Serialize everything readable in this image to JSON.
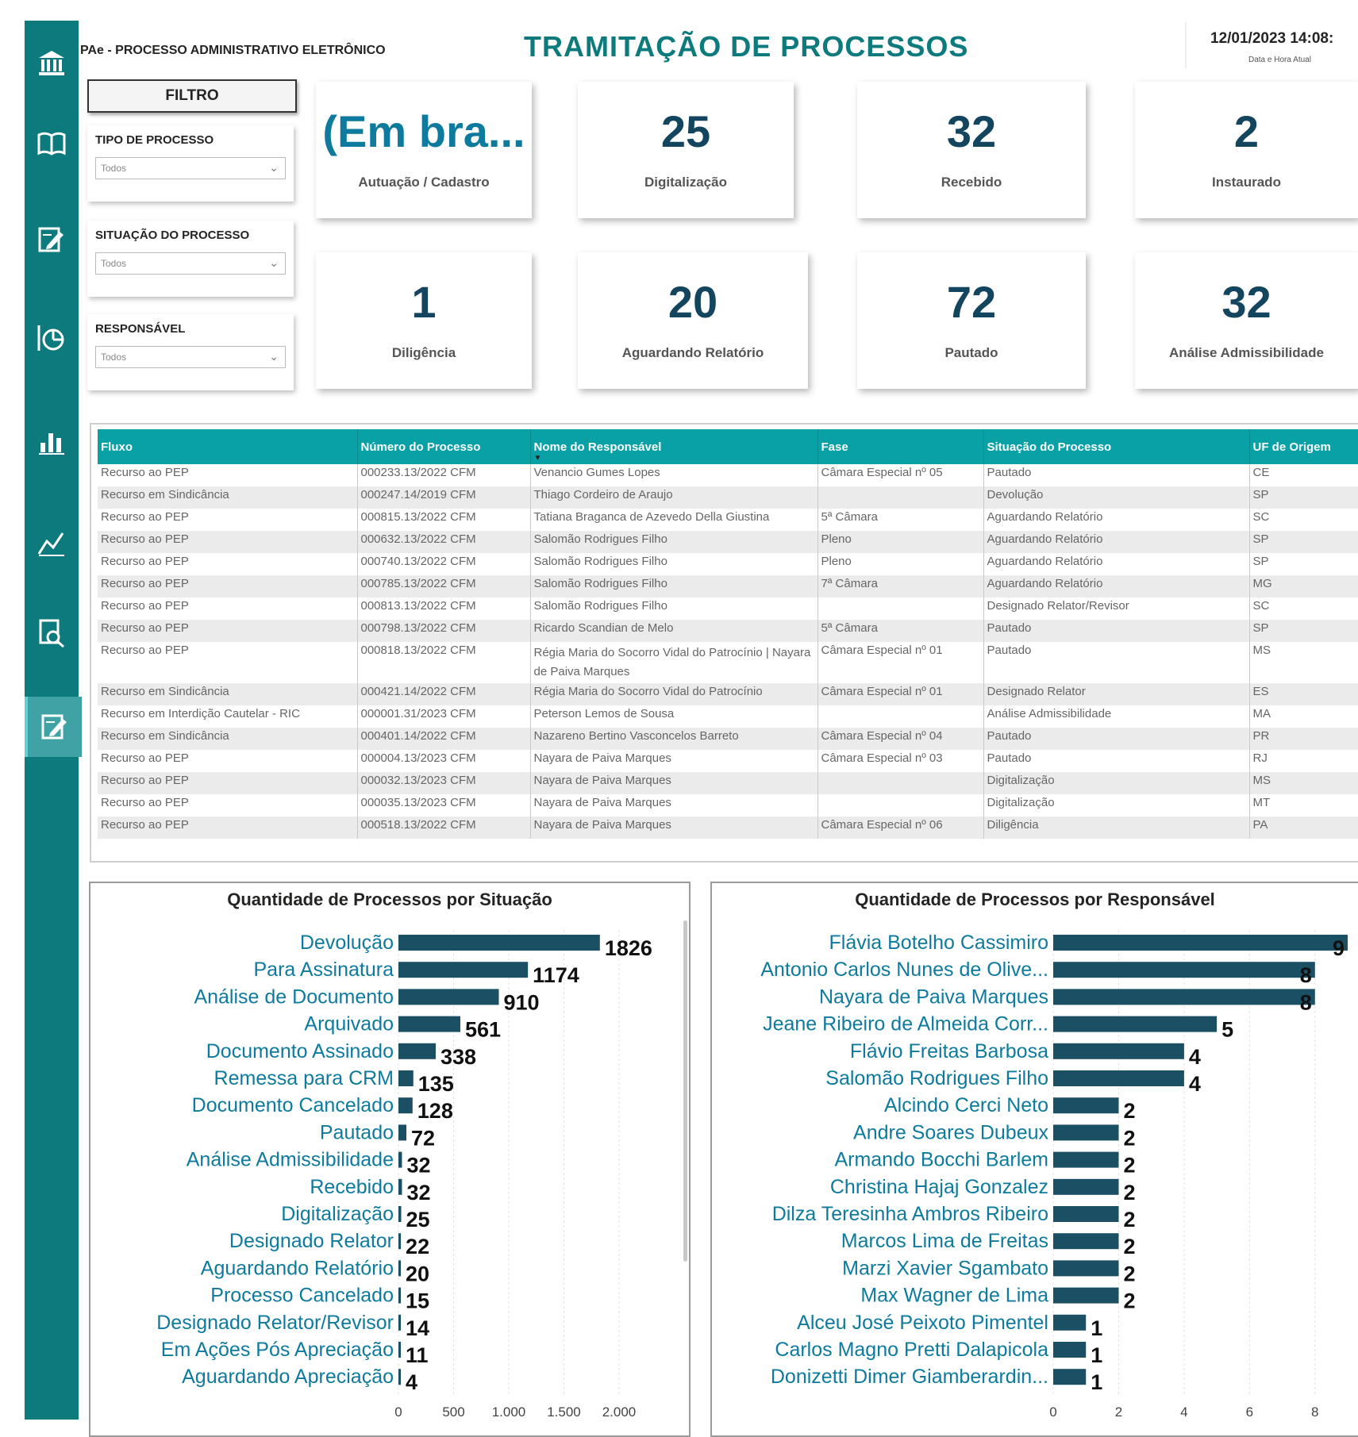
{
  "header": {
    "app_label": "PAe - PROCESSO ADMINISTRATIVO ELETRÔNICO",
    "title": "TRAMITAÇÃO DE PROCESSOS",
    "datetime": "12/01/2023 14:08:",
    "datetime_caption": "Data e Hora Atual"
  },
  "nav": {
    "items": [
      "bank-icon",
      "book-icon",
      "edit-doc-icon",
      "pie-chart-icon",
      "bar-chart-icon",
      "line-chart-icon",
      "search-doc-icon",
      "edit-doc-icon"
    ],
    "active_index": 7
  },
  "filters": {
    "header": "FILTRO",
    "slicers": [
      {
        "label": "TIPO DE PROCESSO",
        "value": "Todos"
      },
      {
        "label": "SITUAÇÃO DO PROCESSO",
        "value": "Todos"
      },
      {
        "label": "RESPONSÁVEL",
        "value": "Todos"
      }
    ]
  },
  "kpis": [
    {
      "value": "(Em bra...",
      "label": "Autuação / Cadastro"
    },
    {
      "value": "25",
      "label": "Digitalização"
    },
    {
      "value": "32",
      "label": "Recebido"
    },
    {
      "value": "2",
      "label": "Instaurado"
    },
    {
      "value": "1",
      "label": "Diligência"
    },
    {
      "value": "20",
      "label": "Aguardando Relatório"
    },
    {
      "value": "72",
      "label": "Pautado"
    },
    {
      "value": "32",
      "label": "Análise Admissibilidade"
    }
  ],
  "table": {
    "columns": [
      "Fluxo",
      "Número do Processo",
      "Nome do Responsável",
      "Fase",
      "Situação do Processo",
      "UF de Origem"
    ],
    "rows": [
      [
        "Recurso ao PEP",
        "000233.13/2022 CFM",
        "Venancio Gumes Lopes",
        "Câmara Especial nº 05",
        "Pautado",
        "CE"
      ],
      [
        "Recurso em Sindicância",
        "000247.14/2019 CFM",
        "Thiago Cordeiro de Araujo",
        "",
        "Devolução",
        "SP"
      ],
      [
        "Recurso ao PEP",
        "000815.13/2022 CFM",
        "Tatiana Braganca de Azevedo Della Giustina",
        "5ª Câmara",
        "Aguardando Relatório",
        "SC"
      ],
      [
        "Recurso ao PEP",
        "000632.13/2022 CFM",
        "Salomão Rodrigues Filho",
        "Pleno",
        "Aguardando Relatório",
        "SP"
      ],
      [
        "Recurso ao PEP",
        "000740.13/2022 CFM",
        "Salomão Rodrigues Filho",
        "Pleno",
        "Aguardando Relatório",
        "SP"
      ],
      [
        "Recurso ao PEP",
        "000785.13/2022 CFM",
        "Salomão Rodrigues Filho",
        "7ª Câmara",
        "Aguardando Relatório",
        "MG"
      ],
      [
        "Recurso ao PEP",
        "000813.13/2022 CFM",
        "Salomão Rodrigues Filho",
        "",
        "Designado Relator/Revisor",
        "SC"
      ],
      [
        "Recurso ao PEP",
        "000798.13/2022 CFM",
        "Ricardo Scandian de Melo",
        "5ª Câmara",
        "Pautado",
        "SP"
      ],
      [
        "Recurso ao PEP",
        "000818.13/2022 CFM",
        "Régia Maria do Socorro Vidal do Patrocínio | Nayara de Paiva Marques",
        "Câmara Especial nº 01",
        "Pautado",
        "MS"
      ],
      [
        "Recurso em Sindicância",
        "000421.14/2022 CFM",
        "Régia Maria do Socorro Vidal do Patrocínio",
        "Câmara Especial nº 01",
        "Designado Relator",
        "ES"
      ],
      [
        "Recurso em Interdição Cautelar - RIC",
        "000001.31/2023 CFM",
        "Peterson Lemos de Sousa",
        "",
        "Análise Admissibilidade",
        "MA"
      ],
      [
        "Recurso em Sindicância",
        "000401.14/2022 CFM",
        "Nazareno Bertino Vasconcelos Barreto",
        "Câmara Especial nº 04",
        "Pautado",
        "PR"
      ],
      [
        "Recurso ao PEP",
        "000004.13/2023 CFM",
        "Nayara de Paiva Marques",
        "Câmara Especial nº 03",
        "Pautado",
        "RJ"
      ],
      [
        "Recurso ao PEP",
        "000032.13/2023 CFM",
        "Nayara de Paiva Marques",
        "",
        "Digitalização",
        "MS"
      ],
      [
        "Recurso ao PEP",
        "000035.13/2023 CFM",
        "Nayara de Paiva Marques",
        "",
        "Digitalização",
        "MT"
      ],
      [
        "Recurso ao PEP",
        "000518.13/2022 CFM",
        "Nayara de Paiva Marques",
        "Câmara Especial nº 06",
        "Diligência",
        "PA"
      ]
    ]
  },
  "chart_data": [
    {
      "type": "bar",
      "orientation": "horizontal",
      "title": "Quantidade de Processos por Situação",
      "categories": [
        "Devolução",
        "Para Assinatura",
        "Análise de Documento",
        "Arquivado",
        "Documento Assinado",
        "Remessa para CRM",
        "Documento Cancelado",
        "Pautado",
        "Análise Admissibilidade",
        "Recebido",
        "Digitalização",
        "Designado Relator",
        "Aguardando Relatório",
        "Processo Cancelado",
        "Designado Relator/Revisor",
        "Em Ações Pós Apreciação",
        "Aguardando Apreciação"
      ],
      "values": [
        1826,
        1174,
        910,
        561,
        338,
        135,
        128,
        72,
        32,
        32,
        25,
        22,
        20,
        15,
        14,
        11,
        4
      ],
      "value_labels": [
        "1826",
        "1174",
        "910",
        "561",
        "338",
        "135",
        "128",
        "72",
        "32",
        "32",
        "25",
        "22",
        "20",
        "15",
        "14",
        "11",
        "4"
      ],
      "xticks": [
        0,
        500,
        1000,
        1500,
        2000
      ],
      "xtick_labels": [
        "0",
        "500",
        "1.000",
        "1.500",
        "2.000"
      ],
      "xlim": [
        0,
        2000
      ],
      "bar_color": "#1b4f63",
      "grid": true
    },
    {
      "type": "bar",
      "orientation": "horizontal",
      "title": "Quantidade de Processos por Responsável",
      "categories": [
        "Flávia Botelho Cassimiro",
        "Antonio Carlos Nunes de Olive...",
        "Nayara de Paiva Marques",
        "Jeane Ribeiro de Almeida Corr...",
        "Flávio Freitas Barbosa",
        "Salomão Rodrigues Filho",
        "Alcindo Cerci Neto",
        "Andre Soares Dubeux",
        "Armando Bocchi Barlem",
        "Christina Hajaj Gonzalez",
        "Dilza Teresinha Ambros Ribeiro",
        "Marcos Lima de Freitas",
        "Marzi Xavier Sgambato",
        "Max Wagner de Lima",
        "Alceu José Peixoto Pimentel",
        "Carlos Magno Pretti Dalapicola",
        "Donizetti Dimer Giamberardin..."
      ],
      "values": [
        9,
        8,
        8,
        5,
        4,
        4,
        2,
        2,
        2,
        2,
        2,
        2,
        2,
        2,
        1,
        1,
        1
      ],
      "value_labels": [
        "9",
        "8",
        "8",
        "5",
        "4",
        "4",
        "2",
        "2",
        "2",
        "2",
        "2",
        "2",
        "2",
        "2",
        "1",
        "1",
        "1"
      ],
      "xticks": [
        0,
        2,
        4,
        6,
        8
      ],
      "xtick_labels": [
        "0",
        "2",
        "4",
        "6",
        "8"
      ],
      "xlim": [
        0,
        9
      ],
      "bar_color": "#1b4f63",
      "grid": true
    }
  ]
}
